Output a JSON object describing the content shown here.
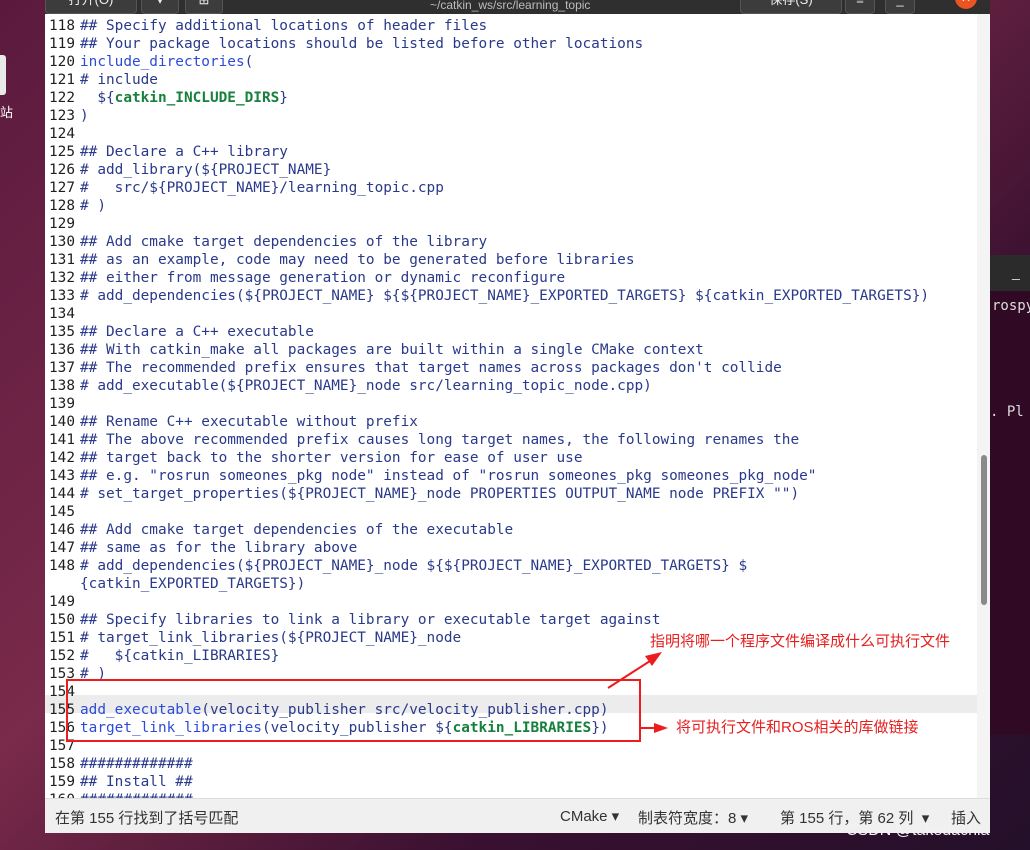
{
  "window": {
    "title": "~/catkin_ws/src/learning_topic",
    "open_label": "打开(O)",
    "save_label": "保存(S)"
  },
  "editor": {
    "lines": [
      {
        "n": "118",
        "text": "## Specify additional locations of header files"
      },
      {
        "n": "119",
        "text": "## Your package locations should be listed before other locations"
      },
      {
        "n": "120",
        "text": "include_directories("
      },
      {
        "n": "121",
        "text": "# include"
      },
      {
        "n": "122",
        "text": "  ${catkin_INCLUDE_DIRS}"
      },
      {
        "n": "123",
        "text": ")"
      },
      {
        "n": "124",
        "text": ""
      },
      {
        "n": "125",
        "text": "## Declare a C++ library"
      },
      {
        "n": "126",
        "text": "# add_library(${PROJECT_NAME}"
      },
      {
        "n": "127",
        "text": "#   src/${PROJECT_NAME}/learning_topic.cpp"
      },
      {
        "n": "128",
        "text": "# )"
      },
      {
        "n": "129",
        "text": ""
      },
      {
        "n": "130",
        "text": "## Add cmake target dependencies of the library"
      },
      {
        "n": "131",
        "text": "## as an example, code may need to be generated before libraries"
      },
      {
        "n": "132",
        "text": "## either from message generation or dynamic reconfigure"
      },
      {
        "n": "133",
        "text": "# add_dependencies(${PROJECT_NAME} ${${PROJECT_NAME}_EXPORTED_TARGETS} ${catkin_EXPORTED_TARGETS})"
      },
      {
        "n": "134",
        "text": ""
      },
      {
        "n": "135",
        "text": "## Declare a C++ executable"
      },
      {
        "n": "136",
        "text": "## With catkin_make all packages are built within a single CMake context"
      },
      {
        "n": "137",
        "text": "## The recommended prefix ensures that target names across packages don't collide"
      },
      {
        "n": "138",
        "text": "# add_executable(${PROJECT_NAME}_node src/learning_topic_node.cpp)"
      },
      {
        "n": "139",
        "text": ""
      },
      {
        "n": "140",
        "text": "## Rename C++ executable without prefix"
      },
      {
        "n": "141",
        "text": "## The above recommended prefix causes long target names, the following renames the"
      },
      {
        "n": "142",
        "text": "## target back to the shorter version for ease of user use"
      },
      {
        "n": "143",
        "text": "## e.g. \"rosrun someones_pkg node\" instead of \"rosrun someones_pkg someones_pkg_node\""
      },
      {
        "n": "144",
        "text": "# set_target_properties(${PROJECT_NAME}_node PROPERTIES OUTPUT_NAME node PREFIX \"\")"
      },
      {
        "n": "145",
        "text": ""
      },
      {
        "n": "146",
        "text": "## Add cmake target dependencies of the executable"
      },
      {
        "n": "147",
        "text": "## same as for the library above"
      },
      {
        "n": "148",
        "text": "# add_dependencies(${PROJECT_NAME}_node ${${PROJECT_NAME}_EXPORTED_TARGETS} $"
      },
      {
        "n": "",
        "text": "{catkin_EXPORTED_TARGETS})"
      },
      {
        "n": "149",
        "text": ""
      },
      {
        "n": "150",
        "text": "## Specify libraries to link a library or executable target against"
      },
      {
        "n": "151",
        "text": "# target_link_libraries(${PROJECT_NAME}_node"
      },
      {
        "n": "152",
        "text": "#   ${catkin_LIBRARIES}"
      },
      {
        "n": "153",
        "text": "# )"
      },
      {
        "n": "154",
        "text": ""
      },
      {
        "n": "155",
        "text": "add_executable(velocity_publisher src/velocity_publisher.cpp)"
      },
      {
        "n": "156",
        "text": "target_link_libraries(velocity_publisher ${catkin_LIBRARIES})"
      },
      {
        "n": "157",
        "text": ""
      },
      {
        "n": "158",
        "text": "#############"
      },
      {
        "n": "159",
        "text": "## Install ##"
      },
      {
        "n": "160",
        "text": "#############"
      }
    ]
  },
  "status": {
    "message": "在第 155 行找到了括号匹配",
    "language": "CMake",
    "tab_width": "制表符宽度：8",
    "position": "第 155 行，第 62 列",
    "mode": "插入"
  },
  "annotations": {
    "note1": "指明将哪一个程序文件编译成什么可执行文件",
    "note2": "将可执行文件和ROS相关的库做链接",
    "color": "#e61e1e"
  },
  "desktop": {
    "icon_label": "站",
    "terminal_text_1": "rospy",
    "terminal_text_2": ". Pl",
    "terminal_min": "_"
  },
  "watermark": "CSDN @takedachia"
}
